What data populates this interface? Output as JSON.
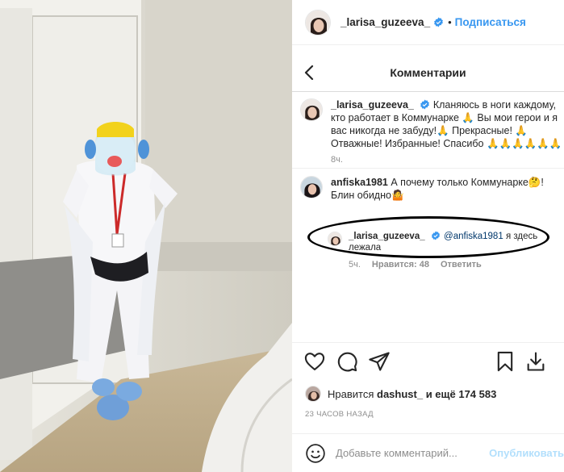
{
  "header": {
    "username": "_larisa_guzeeva_",
    "separator": "•",
    "follow_label": "Подписаться"
  },
  "subheader": {
    "title": "Комментарии"
  },
  "caption": {
    "username": "_larisa_guzeeva_",
    "text": "Кланяюсь в ноги каждому, кто работает в Коммунарке 🙏 Вы мои герои и я вас никогда не забуду!🙏 Прекрасные! 🙏 Отважные! Избранные! Спасибо 🙏🙏🙏🙏🙏🙏",
    "age": "8ч."
  },
  "comments": [
    {
      "username": "anfiska1981",
      "text": "А почему только Коммунарке🤔! Блин обидно🤷"
    }
  ],
  "reply": {
    "username": "_larisa_guzeeva_",
    "mention": "@anfiska1981",
    "text": "я здесь лежала",
    "age": "5ч.",
    "likes": "Нравится: 48",
    "reply_label": "Ответить"
  },
  "likes": {
    "prefix": "Нравится",
    "user": "dashust_",
    "suffix": "и ещё 174 583"
  },
  "timestamp": "23 ЧАСОВ НАЗАД",
  "add_comment": {
    "placeholder": "Добавьте комментарий...",
    "publish_label": "Опубликовать"
  },
  "icons": {
    "verified": "verified-badge-icon",
    "back": "chevron-left-icon",
    "like": "heart-icon",
    "comment": "comment-bubble-icon",
    "share": "paper-plane-icon",
    "save": "bookmark-icon",
    "download": "download-icon",
    "emoji": "smiley-icon"
  },
  "colors": {
    "link": "#3897f0",
    "publish_disabled": "#b2dffc",
    "secondary_text": "#8e8e8e"
  }
}
